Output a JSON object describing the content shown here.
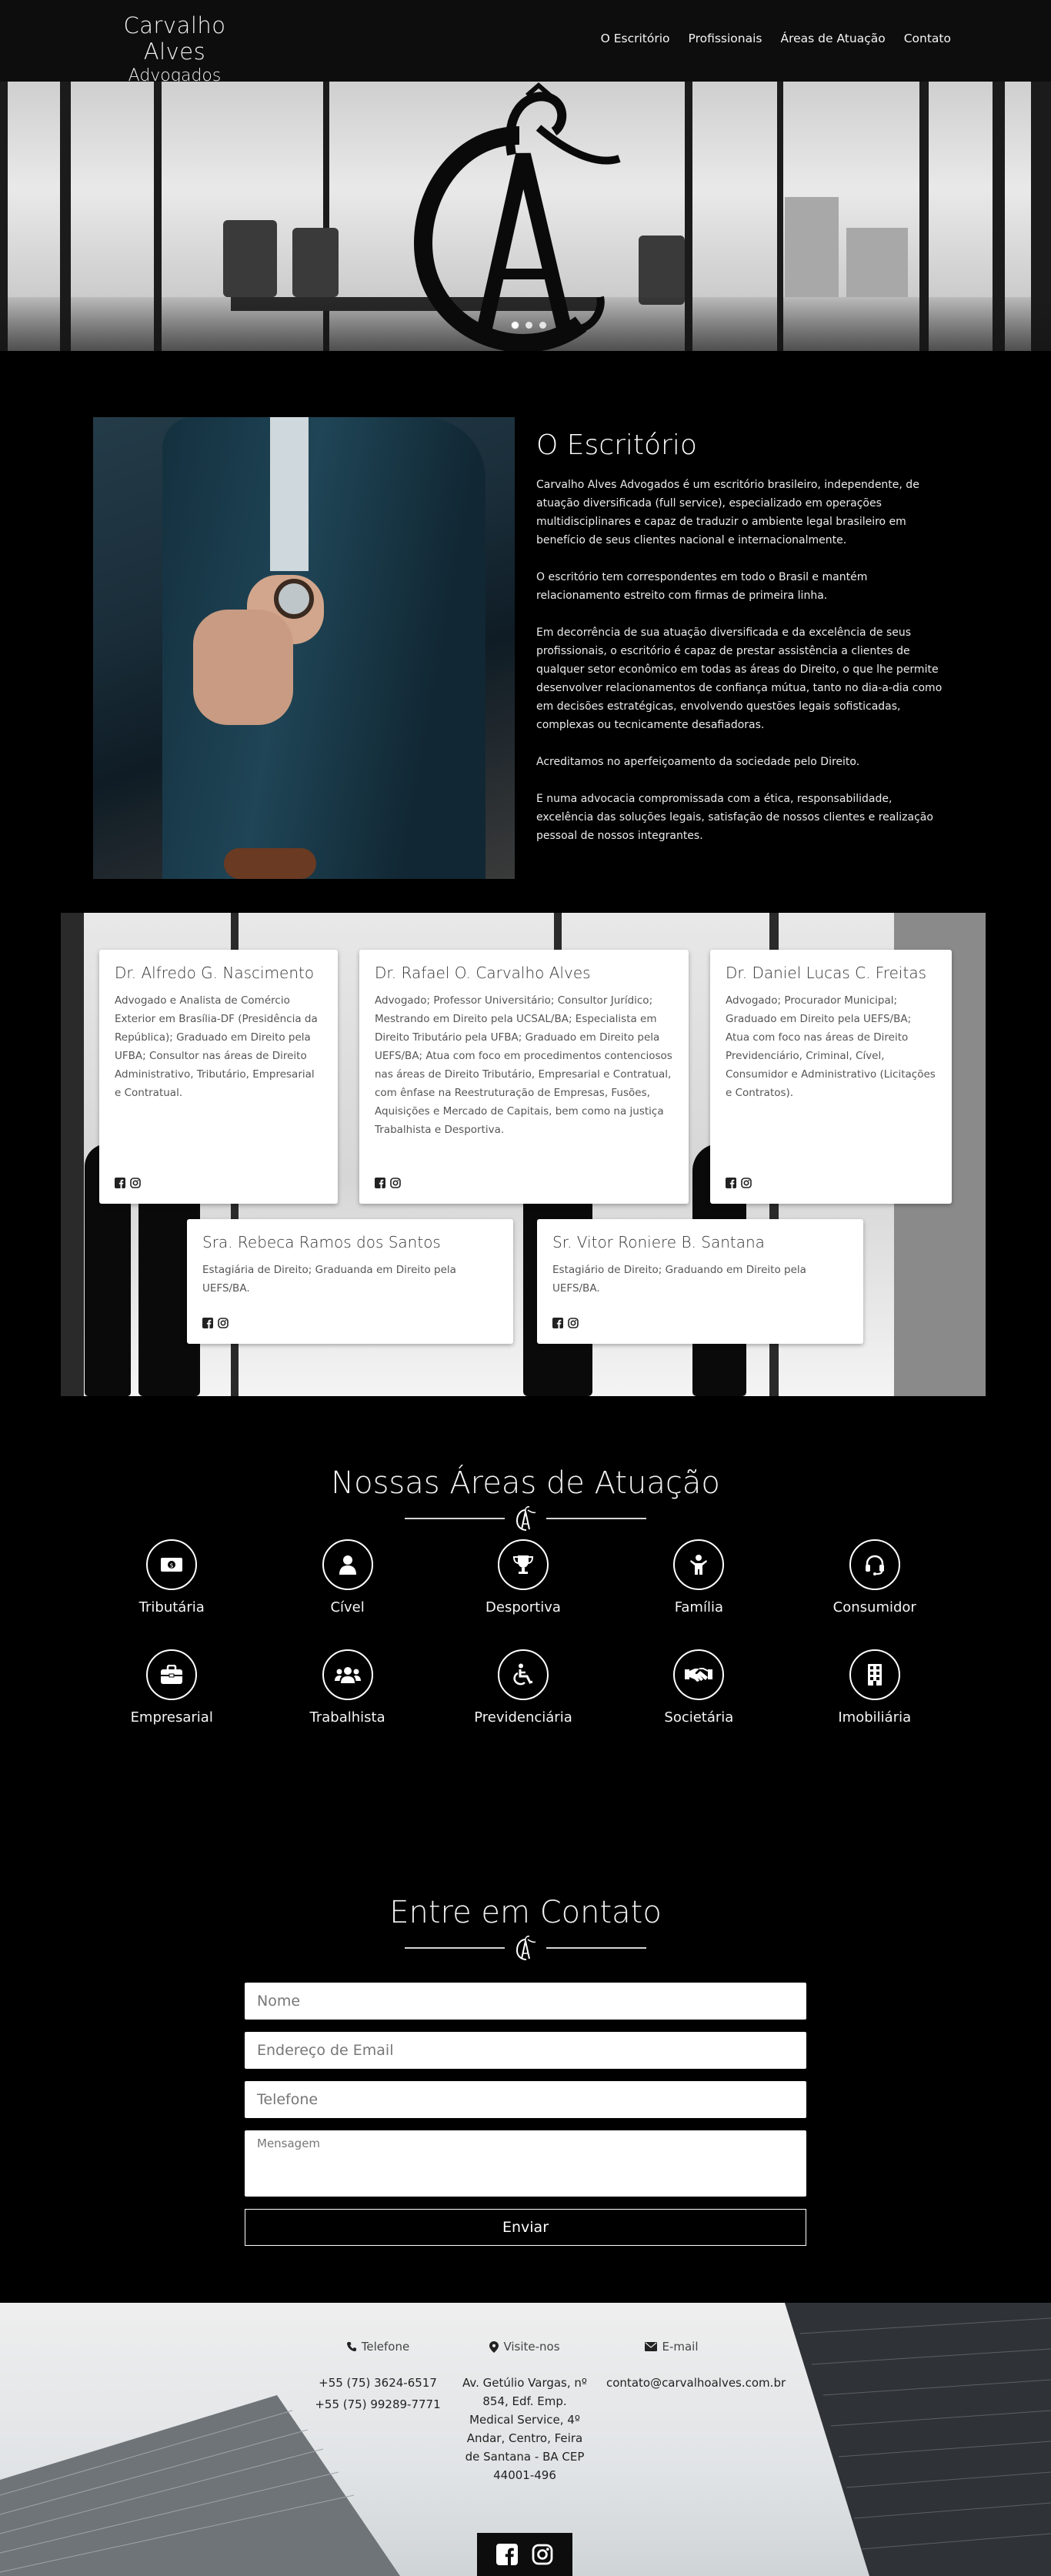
{
  "nav": {
    "brand_line1": "Carvalho Alves",
    "brand_line2": "Advogados",
    "items": [
      "O Escritório",
      "Profissionais",
      "Áreas de Atuação",
      "Contato"
    ]
  },
  "about": {
    "title": "O Escritório",
    "paragraphs": [
      "Carvalho Alves Advogados é um escritório brasileiro, independente, de atuação diversificada (full service), especializado em operações multidisciplinares e capaz de traduzir o ambiente legal brasileiro em benefício de seus clientes nacional e internacionalmente.",
      "O escritório tem correspondentes em todo o Brasil e mantém relacionamento estreito com firmas de primeira linha.",
      "Em decorrência de sua atuação diversificada e da excelência de seus profissionais, o escritório é capaz de prestar assistência a clientes de qualquer setor econômico em todas as áreas do Direito, o que lhe permite desenvolver relacionamentos de confiança mútua, tanto no dia-a-dia como em decisões estratégicas, envolvendo questões legais sofisticadas, complexas ou tecnicamente desafiadoras.",
      "Acreditamos no aperfeiçoamento da sociedade pelo Direito.",
      "E numa advocacia compromissada com a ética, responsabilidade, excelência das soluções legais, satisfação de nossos clientes e realização pessoal de nossos integrantes."
    ]
  },
  "team": [
    {
      "name": "Dr. Alfredo G. Nascimento",
      "bio": "Advogado e Analista de Comércio Exterior em Brasília-DF (Presidência da República); Graduado em Direito pela UFBA; Consultor nas áreas de Direito Administrativo, Tributário, Empresarial e Contratual."
    },
    {
      "name": "Dr. Rafael O. Carvalho Alves",
      "bio": "Advogado; Professor Universitário; Consultor Jurídico; Mestrando em Direito pela UCSAL/BA; Especialista em Direito Tributário pela UFBA; Graduado em Direito pela UEFS/BA; Atua com foco em procedimentos contenciosos nas áreas de Direito Tributário, Empresarial e Contratual, com ênfase na Reestruturação de Empresas, Fusões, Aquisições e Mercado de Capitais, bem como na justiça Trabalhista e Desportiva."
    },
    {
      "name": "Dr. Daniel Lucas C. Freitas",
      "bio": "Advogado; Procurador Municipal; Graduado em Direito pela UEFS/BA; Atua com foco nas áreas de Direito Previdenciário, Criminal, Cível, Consumidor e Administrativo (Licitações e Contratos)."
    },
    {
      "name": "Sra. Rebeca Ramos dos Santos",
      "bio": "Estagiária de Direito; Graduanda em Direito pela UEFS/BA."
    },
    {
      "name": "Sr. Vitor Roniere B. Santana",
      "bio": "Estagiário de Direito; Graduando em Direito pela UEFS/BA."
    }
  ],
  "areas": {
    "title": "Nossas Áreas de Atuação",
    "items": [
      {
        "label": "Tributária",
        "icon": "money-icon"
      },
      {
        "label": "Cível",
        "icon": "user-icon"
      },
      {
        "label": "Desportiva",
        "icon": "trophy-icon"
      },
      {
        "label": "Família",
        "icon": "child-icon"
      },
      {
        "label": "Consumidor",
        "icon": "headset-icon"
      },
      {
        "label": "Empresarial",
        "icon": "briefcase-icon"
      },
      {
        "label": "Trabalhista",
        "icon": "users-icon"
      },
      {
        "label": "Previdenciária",
        "icon": "wheelchair-icon"
      },
      {
        "label": "Societária",
        "icon": "handshake-icon"
      },
      {
        "label": "Imobiliária",
        "icon": "building-icon"
      }
    ]
  },
  "contact": {
    "title": "Entre em Contato",
    "name_placeholder": "Nome",
    "email_placeholder": "Endereço de Email",
    "phone_placeholder": "Telefone",
    "message_placeholder": "Mensagem",
    "submit": "Enviar"
  },
  "footer": {
    "phone_label": "Telefone",
    "phones": [
      "+55 (75) 3624-6517",
      "+55 (75) 99289-7771"
    ],
    "address_label": "Visite-nos",
    "address": "Av. Getúlio Vargas, nº 854, Edf. Emp. Medical Service, 4º Andar, Centro, Feira de Santana - BA CEP 44001-496",
    "email_label": "E-mail",
    "email": "contato@carvalhoalves.com.br"
  }
}
